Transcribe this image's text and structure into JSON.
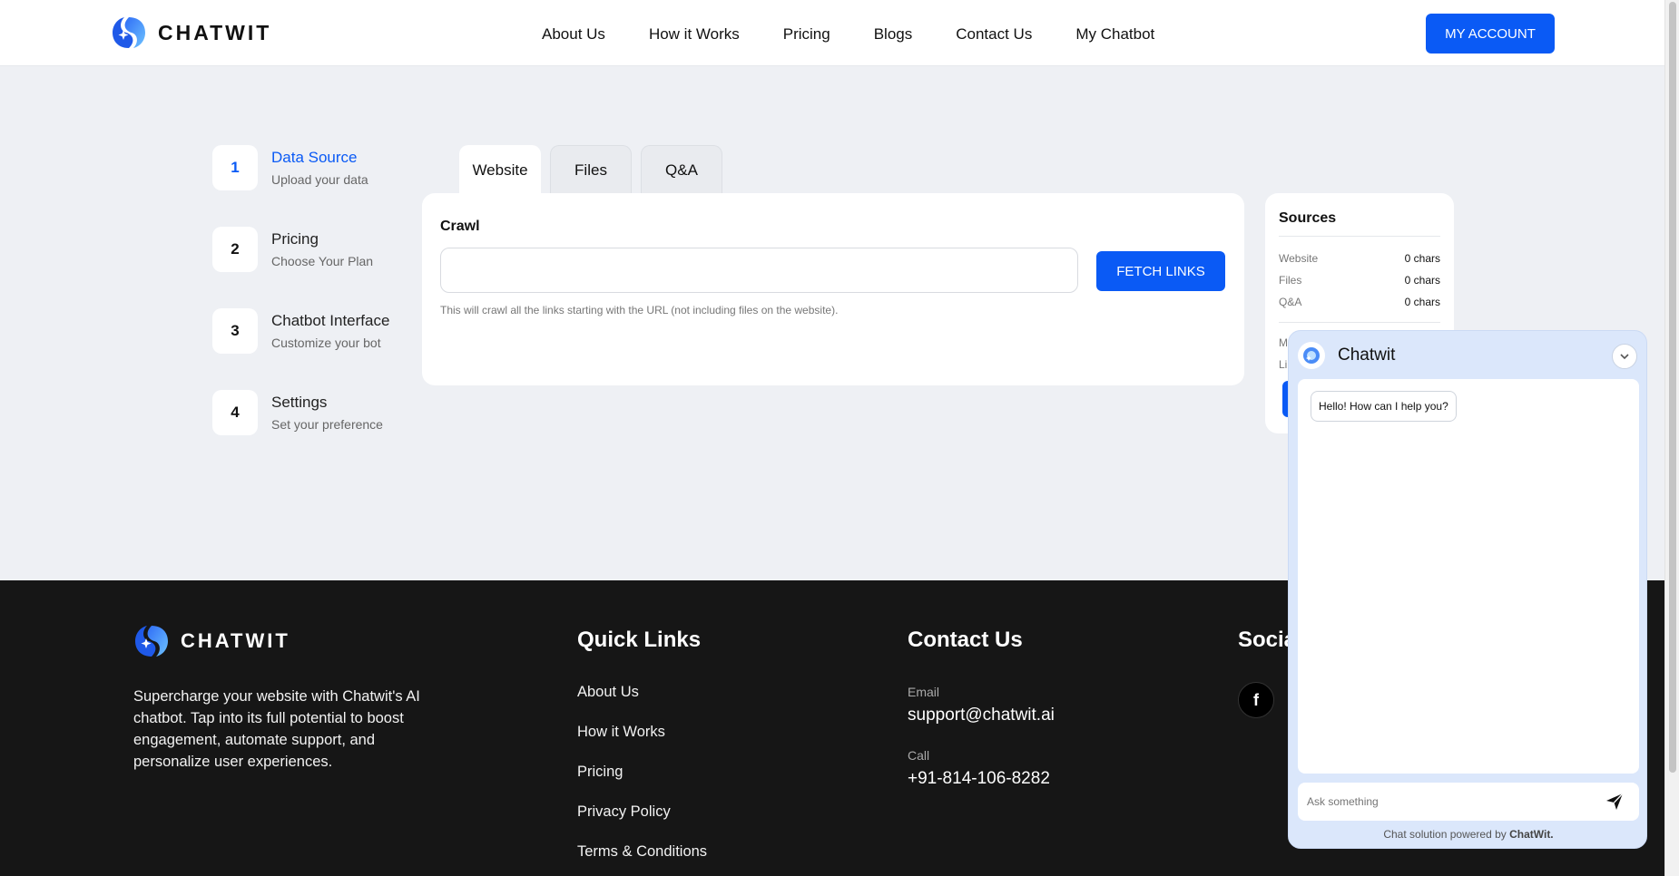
{
  "header": {
    "brand": "CHATWIT",
    "nav": [
      "About Us",
      "How it Works",
      "Pricing",
      "Blogs",
      "Contact Us",
      "My Chatbot"
    ],
    "account_button": "MY ACCOUNT"
  },
  "steps": [
    {
      "number": "1",
      "title": "Data Source",
      "subtitle": "Upload your data",
      "active": true
    },
    {
      "number": "2",
      "title": "Pricing",
      "subtitle": "Choose Your Plan",
      "active": false
    },
    {
      "number": "3",
      "title": "Chatbot Interface",
      "subtitle": "Customize your bot",
      "active": false
    },
    {
      "number": "4",
      "title": "Settings",
      "subtitle": "Set your preference",
      "active": false
    }
  ],
  "tabs": [
    "Website",
    "Files",
    "Q&A"
  ],
  "active_tab": "Website",
  "crawl": {
    "label": "Crawl",
    "url_value": "",
    "fetch_button": "FETCH LINKS",
    "hint": "This will crawl all the links starting with the URL (not including files on the website)."
  },
  "sources": {
    "title": "Sources",
    "rows": [
      {
        "label": "Website",
        "value": "0 chars"
      },
      {
        "label": "Files",
        "value": "0 chars"
      },
      {
        "label": "Q&A",
        "value": "0 chars"
      }
    ],
    "partial_labels": [
      "M",
      "Li"
    ]
  },
  "footer": {
    "brand": "CHATWIT",
    "about": "Supercharge your website with Chatwit's AI chatbot. Tap into its full potential to boost engagement, automate support, and personalize user experiences.",
    "quick_links_title": "Quick Links",
    "quick_links": [
      "About Us",
      "How it Works",
      "Pricing",
      "Privacy Policy",
      "Terms & Conditions"
    ],
    "contact_title": "Contact Us",
    "email_label": "Email",
    "email": "support@chatwit.ai",
    "call_label": "Call",
    "phone": "+91-814-106-8282",
    "social_title": "Socia",
    "social_icon": "f"
  },
  "chat": {
    "name": "Chatwit",
    "greeting": "Hello! How can I help you?",
    "placeholder": "Ask something",
    "powered_prefix": "Chat solution powered by ",
    "powered_brand": "ChatWit."
  },
  "colors": {
    "accent": "#0a5af5",
    "footer_bg": "#161616",
    "page_bg": "#eef0f4",
    "chat_bg": "#dbe7fb"
  }
}
